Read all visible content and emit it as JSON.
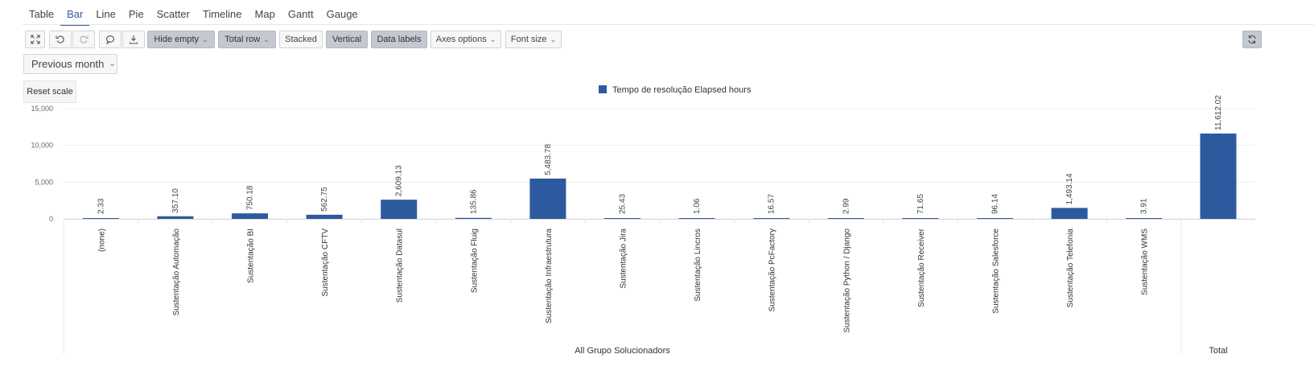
{
  "tabs": [
    "Table",
    "Bar",
    "Line",
    "Pie",
    "Scatter",
    "Timeline",
    "Map",
    "Gantt",
    "Gauge"
  ],
  "active_tab": "Bar",
  "toolbar": {
    "hide_empty": "Hide empty",
    "total_row": "Total row",
    "stacked": "Stacked",
    "vertical": "Vertical",
    "data_labels": "Data labels",
    "axes_options": "Axes options",
    "font_size": "Font size"
  },
  "period": "Previous month",
  "reset_scale": "Reset scale",
  "colors": {
    "bar": "#2d5a9f",
    "grid": "#eeeeee",
    "axis_text": "#666666",
    "active_tab": "#2d5ba0"
  },
  "chart_data": {
    "type": "bar",
    "categories": [
      "(none)",
      "Sustentação Automação",
      "Sustentação BI",
      "Sustentação CFTV",
      "Sustentação Datasul",
      "Sustentação Fluig",
      "Sustentação Infraestrutura",
      "Sustentação Jira",
      "Sustentação Lincros",
      "Sustentação PcFactory",
      "Sustentação Python / Django",
      "Sustentação Receiver",
      "Sustentação Salesforce",
      "Sustentação Telefonia",
      "Sustentação WMS"
    ],
    "values": [
      2.33,
      357.1,
      750.18,
      562.75,
      2609.13,
      135.86,
      5483.78,
      25.43,
      1.06,
      16.57,
      2.99,
      71.65,
      96.14,
      1493.14,
      3.91
    ],
    "value_labels": [
      "2.33",
      "357.10",
      "750.18",
      "562.75",
      "2,609.13",
      "135.86",
      "5,483.78",
      "25.43",
      "1.06",
      "16.57",
      "2.99",
      "71.65",
      "96.14",
      "1,493.14",
      "3.91"
    ],
    "total": {
      "label": "Total",
      "value": 11612.02,
      "value_label": "11,612.02"
    },
    "legend": "Tempo de resolução Elapsed hours",
    "legend_placement": "top-center",
    "group_label": "All Grupo Solucionadors",
    "ylim": [
      0,
      15000
    ],
    "yticks": [
      0,
      5000,
      10000,
      15000
    ],
    "ytick_labels": [
      "0",
      "5,000",
      "10,000",
      "15,000"
    ],
    "grid": true
  }
}
